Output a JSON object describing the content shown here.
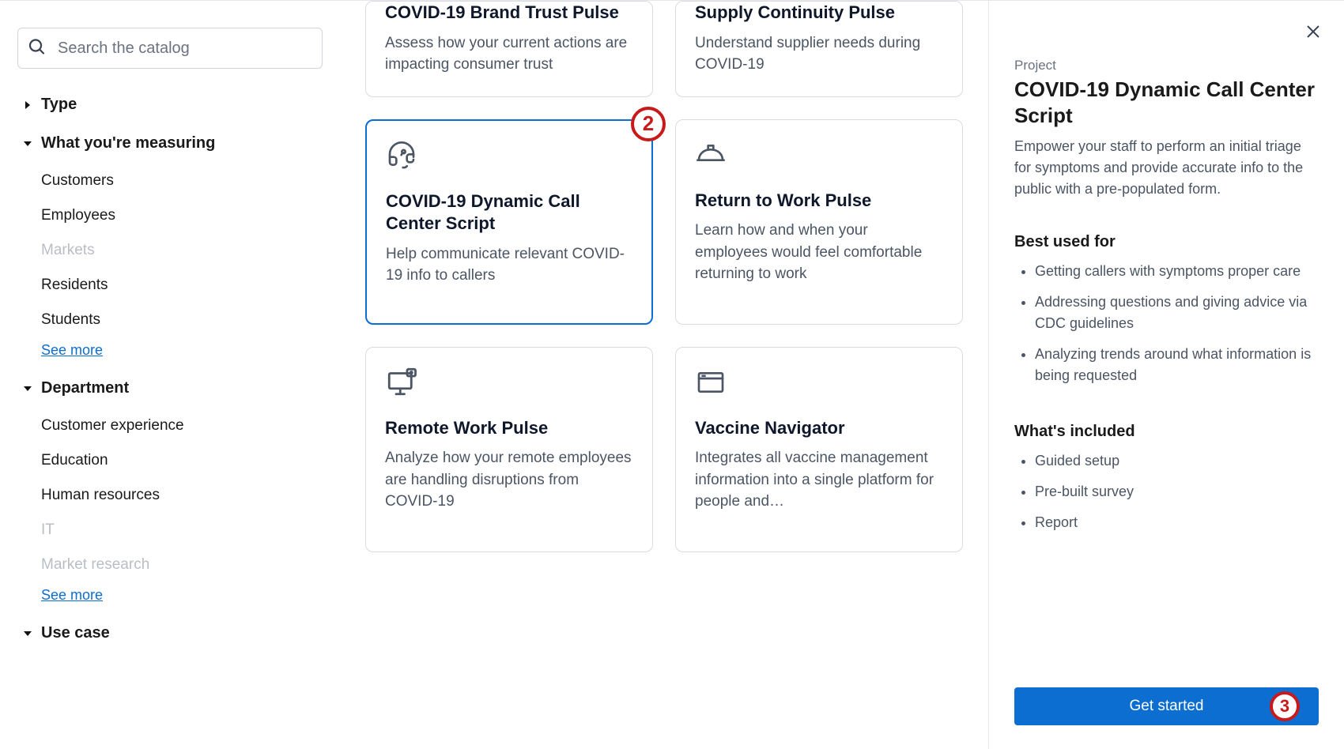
{
  "search": {
    "placeholder": "Search the catalog"
  },
  "filters": {
    "facets": [
      {
        "label": "Type",
        "expanded": false,
        "items": [],
        "see_more": null
      },
      {
        "label": "What you're measuring",
        "expanded": true,
        "items": [
          {
            "label": "Customers",
            "enabled": true
          },
          {
            "label": "Employees",
            "enabled": true
          },
          {
            "label": "Markets",
            "enabled": false
          },
          {
            "label": "Residents",
            "enabled": true
          },
          {
            "label": "Students",
            "enabled": true
          }
        ],
        "see_more": "See more"
      },
      {
        "label": "Department",
        "expanded": true,
        "items": [
          {
            "label": "Customer experience",
            "enabled": true
          },
          {
            "label": "Education",
            "enabled": true
          },
          {
            "label": "Human resources",
            "enabled": true
          },
          {
            "label": "IT",
            "enabled": false
          },
          {
            "label": "Market research",
            "enabled": false
          }
        ],
        "see_more": "See more"
      },
      {
        "label": "Use case",
        "expanded": true,
        "items": [],
        "see_more": null
      }
    ]
  },
  "catalog": {
    "annotation_2": "2",
    "cards": [
      {
        "title": "COVID-19 Brand Trust Pulse",
        "desc": "Assess how your current actions are impacting consumer trust",
        "icon": null,
        "selected": false,
        "partial_top": true
      },
      {
        "title": "Supply Continuity Pulse",
        "desc": "Understand supplier needs during COVID-19",
        "icon": null,
        "selected": false,
        "partial_top": true
      },
      {
        "title": "COVID-19 Dynamic Call Center Script",
        "desc": "Help communicate relevant COVID-19 info to callers",
        "icon": "headset-icon",
        "selected": true,
        "partial_top": false,
        "annotation": "2"
      },
      {
        "title": "Return to Work Pulse",
        "desc": "Learn how and when your employees would feel comfortable returning to work",
        "icon": "hardhat-icon",
        "selected": false,
        "partial_top": false
      },
      {
        "title": "Remote Work Pulse",
        "desc": "Analyze how your remote employees are handling disruptions from COVID-19",
        "icon": "monitor-icon",
        "selected": false,
        "partial_top": false
      },
      {
        "title": "Vaccine Navigator",
        "desc": "Integrates all vaccine management information into a single platform for people and…",
        "icon": "window-icon",
        "selected": false,
        "partial_top": false
      }
    ]
  },
  "detail": {
    "kicker": "Project",
    "title": "COVID-19 Dynamic Call Center Script",
    "desc": "Empower your staff to perform an initial triage for symptoms and provide accurate info to the public with a pre-populated form.",
    "best_used_header": "Best used for",
    "best_used": [
      "Getting callers with symptoms proper care",
      "Addressing questions and giving advice via CDC guidelines",
      "Analyzing trends around what information is being requested"
    ],
    "included_header": "What's included",
    "included": [
      "Guided setup",
      "Pre-built survey",
      "Report"
    ],
    "cta": "Get started",
    "annotation_3": "3"
  }
}
